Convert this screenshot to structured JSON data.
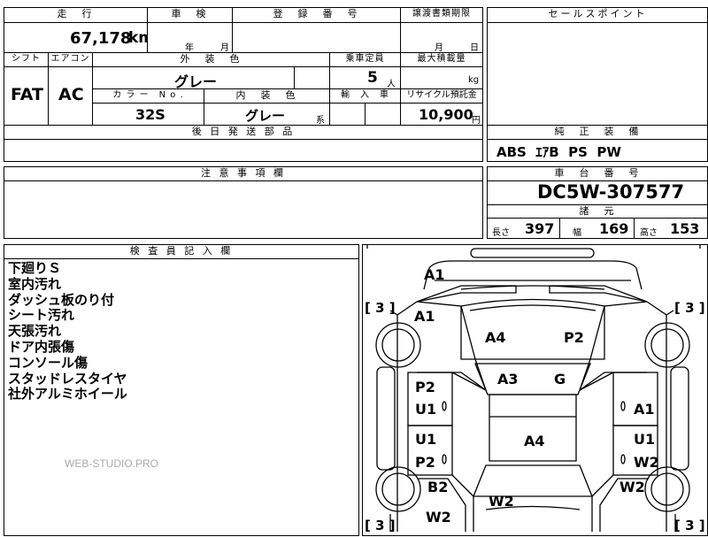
{
  "top": {
    "mileage_label": "走　行",
    "mileage_value": "67,178",
    "mileage_unit": "km",
    "inspection_label": "車　検",
    "inspection_year": "年",
    "inspection_month": "月",
    "registration_label": "登　録　番　号",
    "transfer_label": "譲渡書類期限",
    "transfer_month": "月",
    "transfer_day": "日",
    "shift_label": "シフト",
    "shift_value": "FAT",
    "ac_label": "エアコン",
    "ac_value": "AC",
    "exterior_label": "外　装　色",
    "exterior_value": "グレー",
    "capacity_label": "乗車定員",
    "capacity_value": "5",
    "capacity_unit": "人",
    "load_label": "最大積載量",
    "load_unit": "kg",
    "color_no_label": "カ ラ ー　N o .",
    "color_no_value": "32S",
    "interior_label": "内　装　色",
    "interior_value": "グレー",
    "interior_suffix": "系",
    "import_label": "輸　入　車",
    "recycle_label": "リサイクル預託金",
    "recycle_value": "10,900",
    "recycle_unit": "円",
    "parts_label": "後 日 発 送 部 品"
  },
  "sales": {
    "label": "セールスポイント"
  },
  "equipment": {
    "label": "純　正　装　備",
    "value": "ABS  ｴｱB  PS  PW"
  },
  "notes": {
    "label": "注 意 事 項 欄"
  },
  "chassis": {
    "label": "車　台　番　号",
    "value": "DC5W-307577"
  },
  "specs": {
    "label": "諸　元",
    "length_label": "長さ",
    "length_value": "397",
    "width_label": "幅",
    "width_value": "169",
    "height_label": "高さ",
    "height_value": "153"
  },
  "inspector": {
    "label": "検 査 員 記 入 欄",
    "lines": [
      "下廻りＳ",
      "室内汚れ",
      "ダッシュ板のり付",
      "シート汚れ",
      "天張汚れ",
      "ドア内張傷",
      "コンソール傷",
      "スタッドレスタイヤ",
      "社外アルミホイール"
    ],
    "watermark": "WEB-STUDIO.PRO"
  },
  "diagram": {
    "marks": {
      "front_bumper": "A1",
      "front_left_fender": "A1",
      "hood_left": "A4",
      "hood_right": "P2",
      "windshield": "A3",
      "windshield_g": "G",
      "left_front_door_p": "P2",
      "left_front_door_u": "U1",
      "left_rear_door_u": "U1",
      "left_rear_door_p": "P2",
      "roof": "A4",
      "right_front_door": "A1",
      "right_rear_door_u": "U1",
      "right_rear_door_w": "W2",
      "rear_left_fender_b": "B2",
      "rear_left_fender_w": "W2",
      "rear_right_fender": "W2",
      "rear_glass": "W2",
      "tire_count": "[ 3 ]"
    }
  }
}
